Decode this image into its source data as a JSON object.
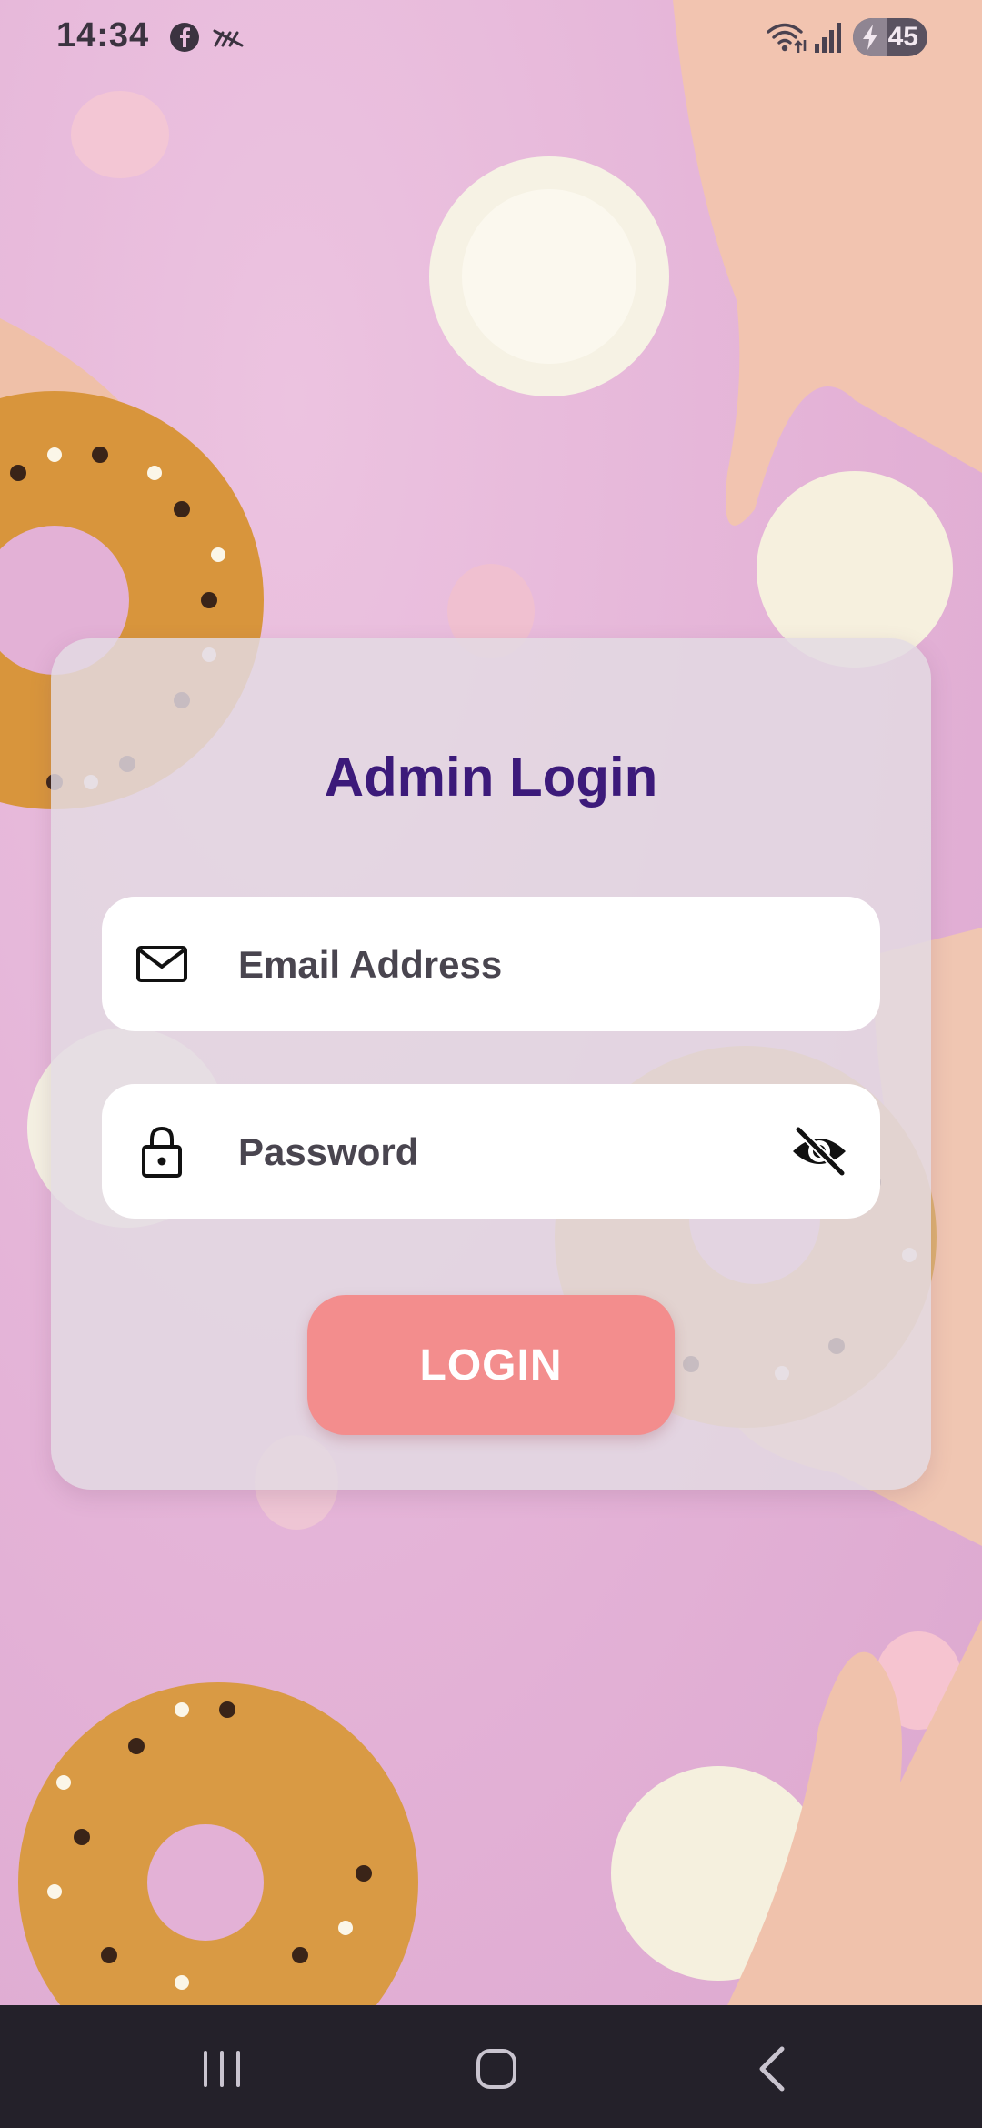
{
  "status_bar": {
    "time": "14:34",
    "battery_level": "45",
    "battery_percent": 45
  },
  "login": {
    "title": "Admin Login",
    "email_placeholder": "Email Address",
    "password_placeholder": "Password",
    "button_label": "LOGIN"
  },
  "icons": {
    "status": [
      "facebook-icon",
      "mute-icon",
      "wifi-icon",
      "signal-icon",
      "battery-charging-icon"
    ],
    "email": "envelope-icon",
    "password": "lock-icon",
    "password_toggle": "eye-off-icon",
    "nav": [
      "recent-apps-icon",
      "home-icon",
      "back-icon"
    ]
  },
  "colors": {
    "background": "#e6b6d9",
    "title": "#3c1a7a",
    "button": "#f38d8d",
    "nav_bar": "#24212a"
  }
}
